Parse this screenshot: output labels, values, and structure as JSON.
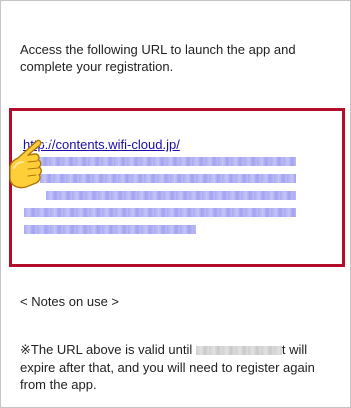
{
  "message": {
    "intro": "Access the following URL to launch the app and complete your registration.",
    "url_text": "http://contents.wifi-cloud.jp/",
    "notes_title": "< Notes on use >",
    "notes_prefix": "※The URL above is valid until",
    "notes_tail": "t",
    "notes_rest": " will expire after that, and you will need to register again from the app."
  },
  "colors": {
    "highlight_border": "#b30d2b",
    "link": "#1a0dab"
  },
  "icons": [
    "pointing-hand-icon"
  ]
}
